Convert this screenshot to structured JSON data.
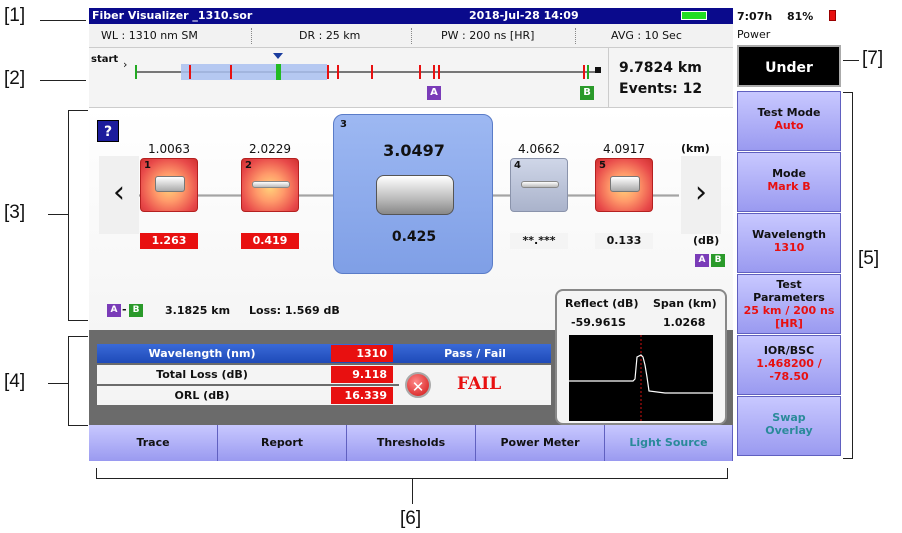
{
  "callouts": [
    "[1]",
    "[2]",
    "[3]",
    "[4]",
    "[5]",
    "[6]",
    "[7]"
  ],
  "titlebar": {
    "filename": "Fiber Visualizer _1310.sor",
    "datetime": "2018-Jul-28 14:09"
  },
  "status": {
    "time_left": "7:07h",
    "battery_pct": "81%",
    "power_label": "Power"
  },
  "info": {
    "wl": "WL : 1310 nm SM",
    "dr": "DR : 25 km",
    "pw": "PW : 200 ns [HR]",
    "avg": "AVG : 10 Sec"
  },
  "overview": {
    "start_label": "start",
    "distance": "9.7824 km",
    "events": "Events: 12",
    "marker_a": "A",
    "marker_b": "B"
  },
  "help_label": "?",
  "events": [
    {
      "num": "1",
      "dist": "1.0063",
      "loss": "1.263",
      "style": "red"
    },
    {
      "num": "2",
      "dist": "2.0229",
      "loss": "0.419",
      "style": "red"
    },
    {
      "num": "3",
      "dist": "3.0497",
      "loss": "0.425",
      "style": "selected"
    },
    {
      "num": "4",
      "dist": "4.0662",
      "loss": "**.***",
      "style": "gray"
    },
    {
      "num": "5",
      "dist": "4.0917",
      "loss": "0.133",
      "style": "red"
    }
  ],
  "units": {
    "km": "(km)",
    "db": "(dB)"
  },
  "nav": {
    "prev": "‹",
    "next": "›"
  },
  "ab_summary": {
    "marker_a": "A",
    "dash": "-",
    "marker_b": "B",
    "distance": "3.1825 km",
    "loss": "Loss: 1.569 dB"
  },
  "reflect": {
    "reflect_label": "Reflect (dB)",
    "span_label": "Span (km)",
    "reflect_value": "-59.961S",
    "span_value": "1.0268"
  },
  "results": {
    "rows": [
      {
        "label": "Wavelength (nm)",
        "value": "1310"
      },
      {
        "label": "Total Loss (dB)",
        "value": "9.118"
      },
      {
        "label": "ORL (dB)",
        "value": "16.339"
      }
    ],
    "pass_fail_label": "Pass / Fail",
    "verdict": "FAIL"
  },
  "tabs": [
    "Trace",
    "Report",
    "Thresholds",
    "Power Meter",
    "Light Source"
  ],
  "right_panel": {
    "under": "Under",
    "buttons": [
      {
        "label": "Test Mode",
        "value": "Auto"
      },
      {
        "label": "Mode",
        "value": "Mark B"
      },
      {
        "label": "Wavelength",
        "value": "1310"
      },
      {
        "label": "Test Parameters",
        "value": "25 km / 200 ns [HR]"
      },
      {
        "label": "IOR/BSC",
        "value": "1.468200 / -78.50"
      },
      {
        "label": "Swap Overlay",
        "value": ""
      }
    ]
  },
  "colors": {
    "title_bg": "#0a0a8c",
    "accent_red": "#e81010",
    "selected_event": "#7f9fe6",
    "tab_bg": "#b0b0f8"
  }
}
